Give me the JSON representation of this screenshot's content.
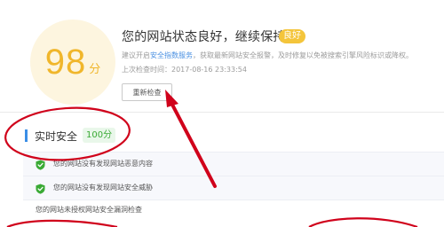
{
  "score": {
    "value": "98",
    "unit": "分"
  },
  "status": {
    "title": "您的网站状态良好，继续保持哦",
    "badge": "良好",
    "advice_prefix": "建议开启",
    "advice_link": "安全指数服务",
    "advice_suffix": "，获取最新网站安全报警，及时修复以免被搜索引擎风险标识或降权。",
    "last_check": "上次检查时间：2017-08-16 23:33:54",
    "recheck_label": "重新检查"
  },
  "section": {
    "title": "实时安全",
    "score": "100分"
  },
  "rows": [
    {
      "text": "您的网站没有发现网站恶意内容",
      "icon": "shield-check-icon"
    },
    {
      "text": "您的网站没有发现网站安全威胁",
      "icon": "shield-check-icon"
    },
    {
      "text": "您的网站未授权网站安全漏洞检查"
    }
  ],
  "colors": {
    "score_accent": "#f0b62b",
    "score_bg": "#fdf5df",
    "badge": "#f4c53b",
    "link": "#4a90e2",
    "ok_green": "#3aaa35",
    "section_bar": "#3a8ee6",
    "annotation_red": "#d0021b"
  }
}
